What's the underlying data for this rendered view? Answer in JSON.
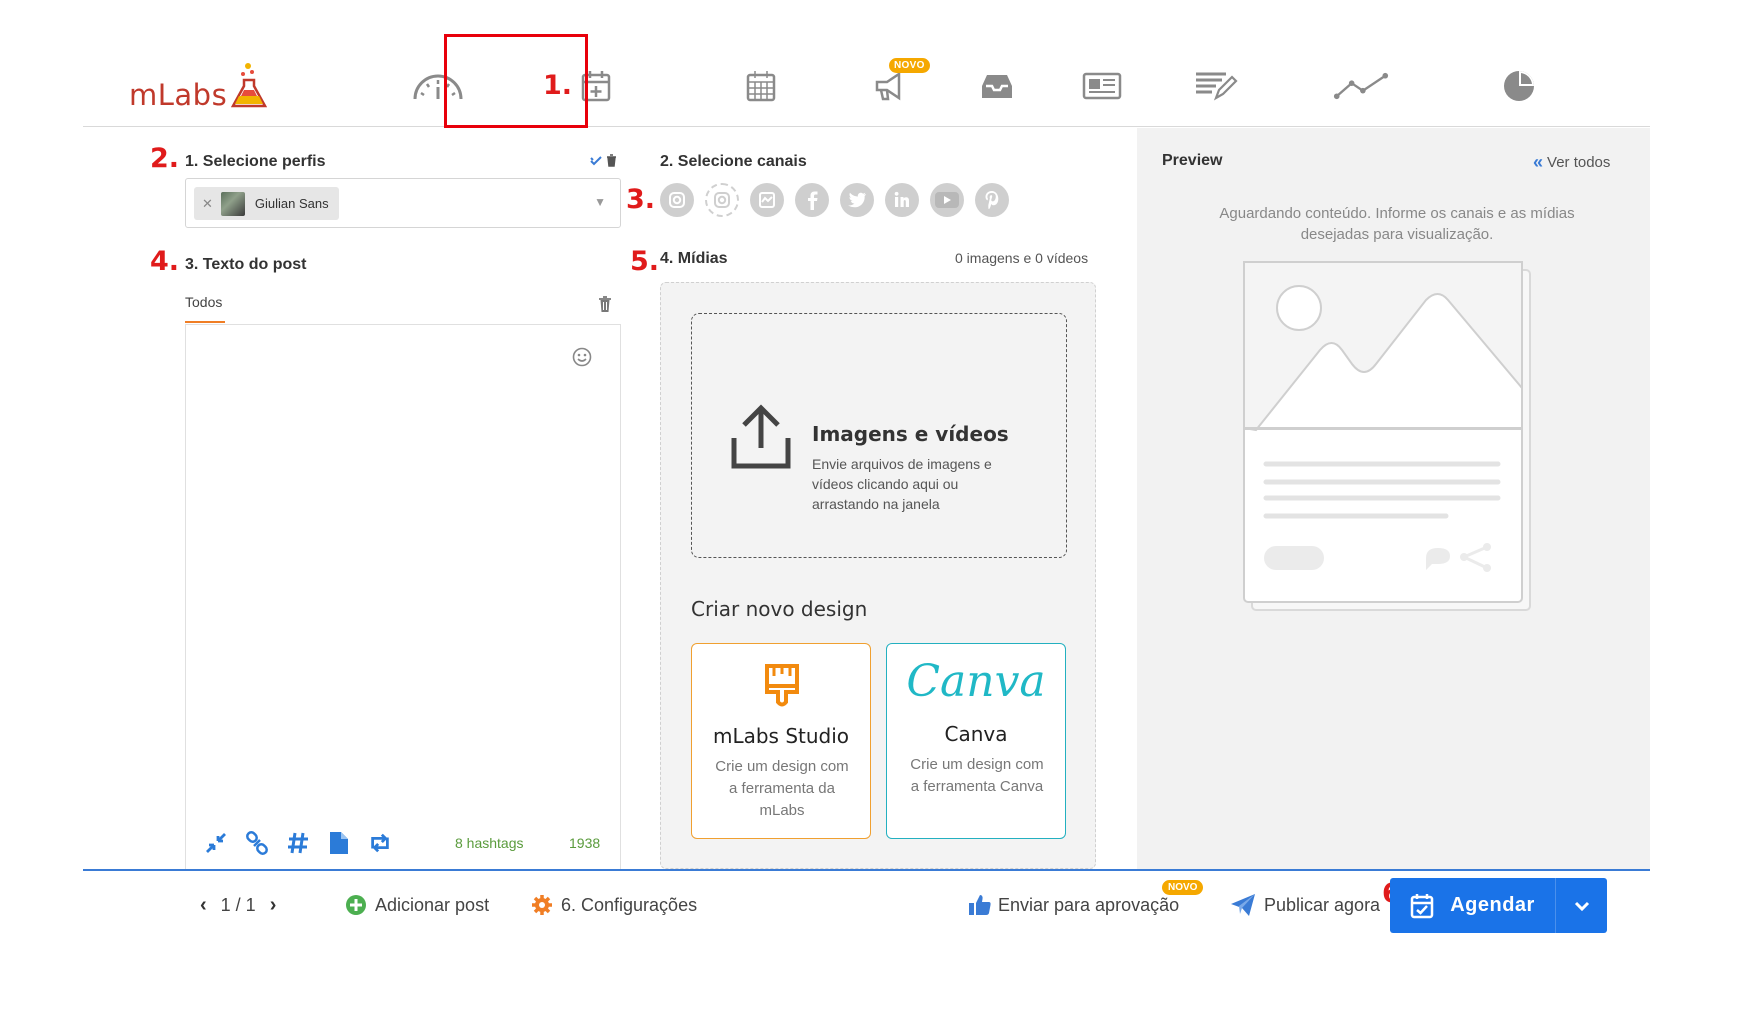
{
  "brand": {
    "logo_text": "mLabs",
    "accent": "#e8000b",
    "primary": "#1a73e8",
    "orange": "#f07e25"
  },
  "nav": {
    "items": [
      {
        "icon": "dashboard-gauge-icon"
      },
      {
        "icon": "calendar-plus-icon",
        "active": true
      },
      {
        "icon": "calendar-icon"
      },
      {
        "icon": "megaphone-icon",
        "badge": "NOVO"
      },
      {
        "icon": "inbox-icon"
      },
      {
        "icon": "newspaper-icon"
      },
      {
        "icon": "edit-list-icon"
      },
      {
        "icon": "line-chart-icon"
      },
      {
        "icon": "pie-chart-icon"
      }
    ]
  },
  "annotations": [
    "1.",
    "2.",
    "3.",
    "4.",
    "5.",
    "6."
  ],
  "profiles": {
    "title": "1. Selecione perfis",
    "selected": [
      {
        "name": "Giulian Sans"
      }
    ]
  },
  "channels": {
    "title": "2. Selecione canais",
    "items": [
      "instagram-icon",
      "instagram-stories-icon",
      "messenger-icon",
      "facebook-icon",
      "twitter-icon",
      "linkedin-icon",
      "youtube-icon",
      "pinterest-icon"
    ]
  },
  "post_text": {
    "title": "3. Texto do post",
    "tab_all": "Todos",
    "hashtags": "8 hashtags",
    "char_count": "1938"
  },
  "media": {
    "title": "4. Mídias",
    "count": "0 imagens e 0 vídeos",
    "upload_title": "Imagens e vídeos",
    "upload_desc": "Envie arquivos de imagens e vídeos clicando aqui ou arrastando na janela",
    "design_title": "Criar novo design",
    "cards": [
      {
        "name": "mLabs Studio",
        "desc": "Crie um design com a ferramenta da mLabs"
      },
      {
        "name": "Canva",
        "logo": "Canva",
        "desc": "Crie um design com a ferramenta Canva"
      }
    ]
  },
  "preview": {
    "title": "Preview",
    "see_all": "Ver todos",
    "message": "Aguardando conteúdo. Informe os canais e as mídias desejadas para visualização."
  },
  "footer": {
    "pager": "1 / 1",
    "add_post": "Adicionar post",
    "settings": "6. Configurações",
    "send_approval": "Enviar para aprovação",
    "send_approval_badge": "NOVO",
    "publish_now": "Publicar agora",
    "schedule": "Agendar"
  }
}
